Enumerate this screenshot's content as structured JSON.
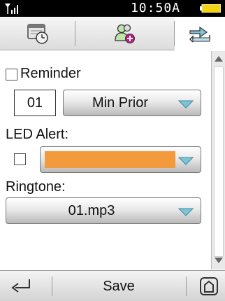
{
  "status": {
    "time": "10:50A",
    "icons": [
      "signal-icon",
      "battery-icon"
    ]
  },
  "tabs": [
    {
      "name": "calendar-clock",
      "icon": "calendar-clock-icon"
    },
    {
      "name": "contacts-add",
      "icon": "people-add-icon"
    },
    {
      "name": "sync",
      "icon": "sync-arrows-icon",
      "active": true
    }
  ],
  "form": {
    "reminder_label": "Reminder",
    "reminder_checked": false,
    "reminder_value": "01",
    "reminder_unit": "Min Prior",
    "led_label": "LED Alert:",
    "led_checked": false,
    "led_color": "#f39a3d",
    "ringtone_label": "Ringtone:",
    "ringtone_value": "01.mp3"
  },
  "bottom": {
    "save_label": "Save",
    "icons": [
      "back-arrow-icon",
      "home-icon"
    ]
  },
  "colors": {
    "accent_arrow": "#7ec3d6",
    "status_bg": "#000000"
  }
}
